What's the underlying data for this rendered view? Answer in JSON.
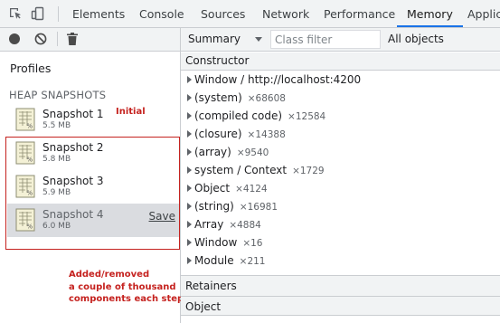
{
  "tabbar": {
    "icons": [
      "inspect-element-icon",
      "device-toolbar-icon"
    ],
    "tabs": [
      {
        "label": "Elements",
        "active": false
      },
      {
        "label": "Console",
        "active": false
      },
      {
        "label": "Sources",
        "active": false
      },
      {
        "label": "Network",
        "active": false
      },
      {
        "label": "Performance",
        "active": false
      },
      {
        "label": "Memory",
        "active": true
      },
      {
        "label": "Applicati",
        "active": false
      }
    ],
    "accent": "#1a73e8"
  },
  "left_toolbar": {
    "icons": [
      "record-icon",
      "clear-icon",
      "garbage-collect-icon"
    ]
  },
  "sidebar": {
    "profiles_label": "Profiles",
    "section_label": "HEAP SNAPSHOTS",
    "snapshots": [
      {
        "name": "Snapshot 1",
        "size": "5.5 MB"
      },
      {
        "name": "Snapshot 2",
        "size": "5.8 MB"
      },
      {
        "name": "Snapshot 3",
        "size": "5.9 MB"
      },
      {
        "name": "Snapshot 4",
        "size": "6.0 MB",
        "selected": true,
        "action": "Save"
      }
    ]
  },
  "annotations": {
    "initial": "Initial",
    "note_lines": [
      "Added/removed",
      "a couple of thousand",
      "components each step"
    ],
    "color": "#c5221f"
  },
  "right_toolbar": {
    "view": "Summary",
    "filter_placeholder": "Class filter",
    "scope": "All objects"
  },
  "constructor_table": {
    "header": "Constructor",
    "rows": [
      {
        "name": "Window / http://localhost:4200",
        "count": ""
      },
      {
        "name": "(system)",
        "count": "×68608"
      },
      {
        "name": "(compiled code)",
        "count": "×12584"
      },
      {
        "name": "(closure)",
        "count": "×14388"
      },
      {
        "name": "(array)",
        "count": "×9540"
      },
      {
        "name": "system / Context",
        "count": "×1729"
      },
      {
        "name": "Object",
        "count": "×4124"
      },
      {
        "name": "(string)",
        "count": "×16981"
      },
      {
        "name": "Array",
        "count": "×4884"
      },
      {
        "name": "Window",
        "count": "×16"
      },
      {
        "name": "Module",
        "count": "×211"
      }
    ]
  },
  "bottom_panel": {
    "retainers_label": "Retainers",
    "object_label": "Object"
  }
}
